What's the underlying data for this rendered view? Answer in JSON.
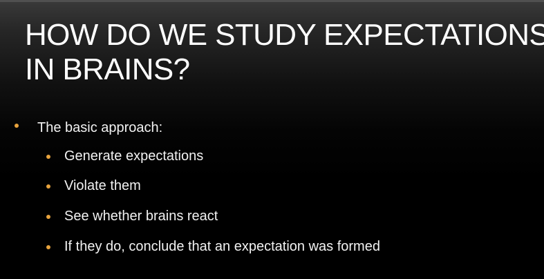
{
  "slide": {
    "title_line1": "HOW DO WE STUDY EXPECTATIONS",
    "title_line2": "IN BRAINS?",
    "bullet_color": "#e8a33d",
    "level1": {
      "text": "The basic approach:"
    },
    "level2": [
      {
        "text": "Generate expectations"
      },
      {
        "text": "Violate them"
      },
      {
        "text": "See whether brains react"
      },
      {
        "text": "If they do, conclude that an expectation was formed"
      }
    ]
  }
}
